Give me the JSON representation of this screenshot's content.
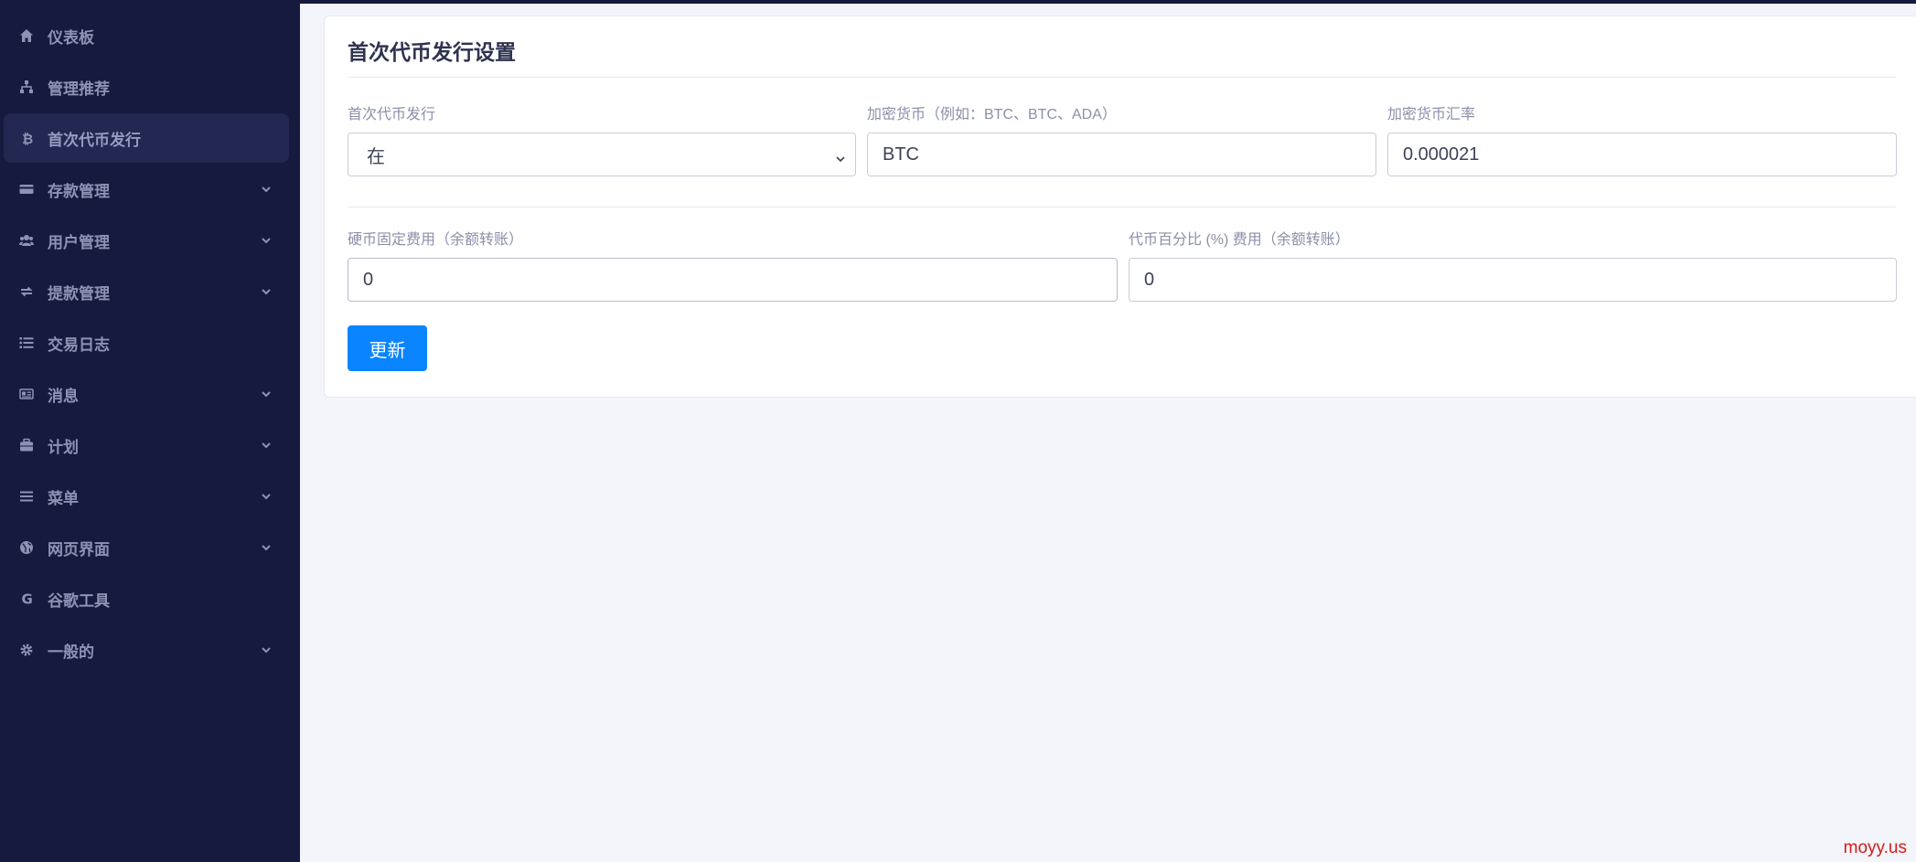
{
  "sidebar": {
    "items": [
      {
        "label": "仪表板",
        "icon": "home-icon",
        "has_submenu": false,
        "active": false
      },
      {
        "label": "管理推荐",
        "icon": "sitemap-icon",
        "has_submenu": false,
        "active": false
      },
      {
        "label": "首次代币发行",
        "icon": "bitcoin-icon",
        "has_submenu": false,
        "active": true
      },
      {
        "label": "存款管理",
        "icon": "credit-card-icon",
        "has_submenu": true,
        "active": false
      },
      {
        "label": "用户管理",
        "icon": "users-icon",
        "has_submenu": true,
        "active": false
      },
      {
        "label": "提款管理",
        "icon": "exchange-icon",
        "has_submenu": true,
        "active": false
      },
      {
        "label": "交易日志",
        "icon": "list-icon",
        "has_submenu": false,
        "active": false
      },
      {
        "label": "消息",
        "icon": "newspaper-icon",
        "has_submenu": true,
        "active": false
      },
      {
        "label": "计划",
        "icon": "briefcase-icon",
        "has_submenu": true,
        "active": false
      },
      {
        "label": "菜单",
        "icon": "bars-icon",
        "has_submenu": true,
        "active": false
      },
      {
        "label": "网页界面",
        "icon": "globe-icon",
        "has_submenu": true,
        "active": false
      },
      {
        "label": "谷歌工具",
        "icon": "google-icon",
        "has_submenu": false,
        "active": false
      },
      {
        "label": "一般的",
        "icon": "gear-icon",
        "has_submenu": true,
        "active": false
      }
    ]
  },
  "card": {
    "title": "首次代币发行设置",
    "ico_label": "首次代币发行",
    "ico_value": "在",
    "currency_label": "加密货币（例如：BTC、BTC、ADA）",
    "currency_value": "BTC",
    "rate_label": "加密货币汇率",
    "rate_value": "0.000021",
    "fixed_fee_label": "硬币固定费用（余额转账）",
    "fixed_fee_value": "0",
    "percent_fee_label": "代币百分比 (%) 费用（余额转账）",
    "percent_fee_value": "0",
    "update_button": "更新"
  },
  "watermark": "moyy.us",
  "colors": {
    "sidebar_bg": "#161a3f",
    "active_item_bg": "#232852",
    "primary_button": "#0a84ff",
    "page_bg": "#f4f5fa"
  }
}
